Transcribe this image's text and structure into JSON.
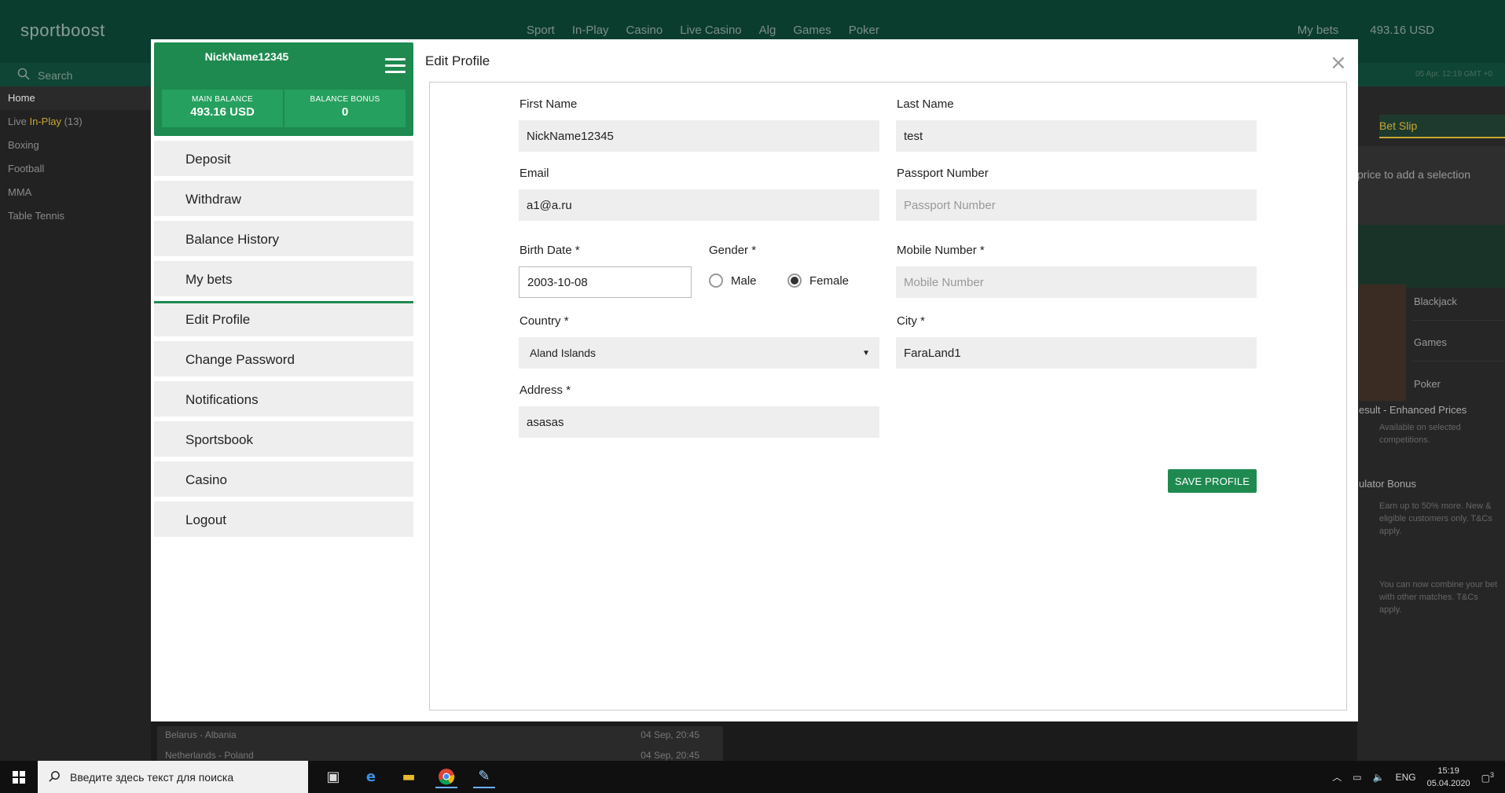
{
  "site": {
    "logo": "sportboost",
    "nav": [
      "Sport",
      "In-Play",
      "Casino",
      "Live Casino",
      "Alg",
      "Games",
      "Poker"
    ],
    "my_bets": "My bets",
    "balance": "493.16 USD",
    "search_label": "Search",
    "datetime": "05 Apr, 12:19 GMT +0"
  },
  "sidebar": {
    "items": [
      {
        "label": "Home"
      },
      {
        "label": "Live",
        "highlight": "In-Play",
        "count": "(13)"
      },
      {
        "label": "Boxing"
      },
      {
        "label": "Football"
      },
      {
        "label": "MMA"
      },
      {
        "label": "Table Tennis"
      }
    ]
  },
  "right_panel": {
    "bet_slip": "Bet Slip",
    "hint": "price to add a selection",
    "casino": [
      "Blackjack",
      "Games",
      "Poker"
    ],
    "promos": [
      {
        "title": "esult - Enhanced Prices",
        "text": "Available on selected competitions."
      },
      {
        "title": "ulator Bonus",
        "text": "Earn up to 50% more. New & eligible customers only. T&Cs apply."
      },
      {
        "title": "",
        "text": "You can now combine your bet with other matches. T&Cs apply."
      }
    ]
  },
  "matches": [
    {
      "name": "Belarus - Albania",
      "time": "04 Sep, 20:45"
    },
    {
      "name": "Netherlands - Poland",
      "time": "04 Sep, 20:45"
    }
  ],
  "modal": {
    "nickname": "NickName12345",
    "main_balance_label": "MAIN BALANCE",
    "main_balance": "493.16 USD",
    "bonus_label": "BALANCE BONUS",
    "bonus": "0",
    "menu": [
      "Deposit",
      "Withdraw",
      "Balance History",
      "My bets",
      "Edit Profile",
      "Change Password",
      "Notifications",
      "Sportsbook",
      "Casino",
      "Logout"
    ],
    "title": "Edit Profile",
    "close": "×"
  },
  "form": {
    "first_name": {
      "label": "First Name",
      "value": "NickName12345"
    },
    "last_name": {
      "label": "Last Name",
      "value": "test"
    },
    "email": {
      "label": "Email",
      "value": "a1@a.ru"
    },
    "passport": {
      "label": "Passport Number",
      "placeholder": "Passport Number"
    },
    "birth_date": {
      "label": "Birth Date *",
      "value": "2003-10-08"
    },
    "gender": {
      "label": "Gender *",
      "options": [
        "Male",
        "Female"
      ],
      "selected": "Female"
    },
    "mobile": {
      "label": "Mobile Number *",
      "placeholder": "Mobile Number"
    },
    "country": {
      "label": "Country *",
      "value": "Aland Islands"
    },
    "city": {
      "label": "City *",
      "value": "FaraLand1"
    },
    "address": {
      "label": "Address *",
      "value": "asasas"
    },
    "save": "SAVE PROFILE"
  },
  "taskbar": {
    "search_placeholder": "Введите здесь текст для поиска",
    "lang": "ENG",
    "time": "15:19",
    "date": "05.04.2020",
    "notif_count": "3"
  }
}
